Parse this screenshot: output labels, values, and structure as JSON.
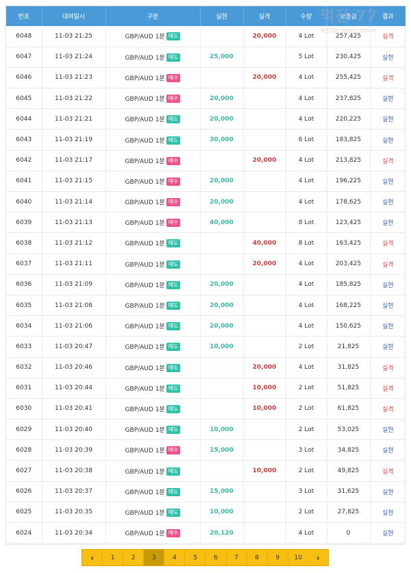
{
  "table": {
    "headers": [
      "번호",
      "대여일시",
      "구분",
      "실현",
      "실격",
      "수량",
      "보증금",
      "결과"
    ],
    "rows": [
      {
        "no": "6048",
        "time": "11-03 21:25",
        "product": "GBP/AUD 1분",
        "side": "매도",
        "side_type": "sell",
        "profit": "",
        "loss": "20,000",
        "qty": "4 Lot",
        "deposit": "257,425",
        "result": "실격",
        "result_type": "loss"
      },
      {
        "no": "6047",
        "time": "11-03 21:24",
        "product": "GBP/AUD 1분",
        "side": "매도",
        "side_type": "sell",
        "profit": "25,000",
        "loss": "",
        "qty": "5 Lot",
        "deposit": "230,425",
        "result": "실현",
        "result_type": "profit"
      },
      {
        "no": "6046",
        "time": "11-03 21:23",
        "product": "GBP/AUD 1분",
        "side": "매수",
        "side_type": "buy",
        "profit": "",
        "loss": "20,000",
        "qty": "4 Lot",
        "deposit": "255,425",
        "result": "실격",
        "result_type": "loss"
      },
      {
        "no": "6045",
        "time": "11-03 21:22",
        "product": "GBP/AUD 1분",
        "side": "매수",
        "side_type": "buy",
        "profit": "20,000",
        "loss": "",
        "qty": "4 Lot",
        "deposit": "237,825",
        "result": "실현",
        "result_type": "profit"
      },
      {
        "no": "6044",
        "time": "11-03 21:21",
        "product": "GBP/AUD 1분",
        "side": "매도",
        "side_type": "sell",
        "profit": "20,000",
        "loss": "",
        "qty": "4 Lot",
        "deposit": "220,225",
        "result": "실현",
        "result_type": "profit"
      },
      {
        "no": "6043",
        "time": "11-03 21:19",
        "product": "GBP/AUD 1분",
        "side": "매도",
        "side_type": "sell",
        "profit": "30,000",
        "loss": "",
        "qty": "6 Lot",
        "deposit": "183,825",
        "result": "실현",
        "result_type": "profit"
      },
      {
        "no": "6042",
        "time": "11-03 21:17",
        "product": "GBP/AUD 1분",
        "side": "매수",
        "side_type": "buy",
        "profit": "",
        "loss": "20,000",
        "qty": "4 Lot",
        "deposit": "213,825",
        "result": "실격",
        "result_type": "loss"
      },
      {
        "no": "6041",
        "time": "11-03 21:15",
        "product": "GBP/AUD 1분",
        "side": "매수",
        "side_type": "buy",
        "profit": "20,000",
        "loss": "",
        "qty": "4 Lot",
        "deposit": "196,225",
        "result": "실현",
        "result_type": "profit"
      },
      {
        "no": "6040",
        "time": "11-03 21:14",
        "product": "GBP/AUD 1분",
        "side": "매수",
        "side_type": "buy",
        "profit": "20,000",
        "loss": "",
        "qty": "4 Lot",
        "deposit": "178,625",
        "result": "실현",
        "result_type": "profit"
      },
      {
        "no": "6039",
        "time": "11-03 21:13",
        "product": "GBP/AUD 1분",
        "side": "매수",
        "side_type": "buy",
        "profit": "40,000",
        "loss": "",
        "qty": "8 Lot",
        "deposit": "123,425",
        "result": "실현",
        "result_type": "profit"
      },
      {
        "no": "6038",
        "time": "11-03 21:12",
        "product": "GBP/AUD 1분",
        "side": "매도",
        "side_type": "sell",
        "profit": "",
        "loss": "40,000",
        "qty": "8 Lot",
        "deposit": "163,425",
        "result": "실격",
        "result_type": "loss"
      },
      {
        "no": "6037",
        "time": "11-03 21:11",
        "product": "GBP/AUD 1분",
        "side": "매도",
        "side_type": "sell",
        "profit": "",
        "loss": "20,000",
        "qty": "4 Lot",
        "deposit": "203,425",
        "result": "실격",
        "result_type": "loss"
      },
      {
        "no": "6036",
        "time": "11-03 21:09",
        "product": "GBP/AUD 1분",
        "side": "매도",
        "side_type": "sell",
        "profit": "20,000",
        "loss": "",
        "qty": "4 Lot",
        "deposit": "185,825",
        "result": "실현",
        "result_type": "profit"
      },
      {
        "no": "6035",
        "time": "11-03 21:08",
        "product": "GBP/AUD 1분",
        "side": "매도",
        "side_type": "sell",
        "profit": "20,000",
        "loss": "",
        "qty": "4 Lot",
        "deposit": "168,225",
        "result": "실현",
        "result_type": "profit"
      },
      {
        "no": "6034",
        "time": "11-03 21:06",
        "product": "GBP/AUD 1분",
        "side": "매도",
        "side_type": "sell",
        "profit": "20,000",
        "loss": "",
        "qty": "4 Lot",
        "deposit": "150,625",
        "result": "실현",
        "result_type": "profit"
      },
      {
        "no": "6033",
        "time": "11-03 20:47",
        "product": "GBP/AUD 1분",
        "side": "매도",
        "side_type": "sell",
        "profit": "10,000",
        "loss": "",
        "qty": "2 Lot",
        "deposit": "21,825",
        "result": "실현",
        "result_type": "profit"
      },
      {
        "no": "6032",
        "time": "11-03 20:46",
        "product": "GBP/AUD 1분",
        "side": "매도",
        "side_type": "sell",
        "profit": "",
        "loss": "20,000",
        "qty": "4 Lot",
        "deposit": "31,825",
        "result": "실격",
        "result_type": "loss"
      },
      {
        "no": "6031",
        "time": "11-03 20:44",
        "product": "GBP/AUD 1분",
        "side": "매도",
        "side_type": "sell",
        "profit": "",
        "loss": "10,000",
        "qty": "2 Lot",
        "deposit": "51,825",
        "result": "실격",
        "result_type": "loss"
      },
      {
        "no": "6030",
        "time": "11-03 20:41",
        "product": "GBP/AUD 1분",
        "side": "매도",
        "side_type": "sell",
        "profit": "",
        "loss": "10,000",
        "qty": "2 Lot",
        "deposit": "61,825",
        "result": "실격",
        "result_type": "loss"
      },
      {
        "no": "6029",
        "time": "11-03 20:40",
        "product": "GBP/AUD 1분",
        "side": "매도",
        "side_type": "sell",
        "profit": "10,000",
        "loss": "",
        "qty": "2 Lot",
        "deposit": "53,025",
        "result": "실현",
        "result_type": "profit"
      },
      {
        "no": "6028",
        "time": "11-03 20:39",
        "product": "GBP/AUD 1분",
        "side": "매수",
        "side_type": "buy",
        "profit": "15,000",
        "loss": "",
        "qty": "3 Lot",
        "deposit": "34,825",
        "result": "실현",
        "result_type": "profit"
      },
      {
        "no": "6027",
        "time": "11-03 20:38",
        "product": "GBP/AUD 1분",
        "side": "매도",
        "side_type": "sell",
        "profit": "",
        "loss": "10,000",
        "qty": "2 Lot",
        "deposit": "49,825",
        "result": "실격",
        "result_type": "loss"
      },
      {
        "no": "6026",
        "time": "11-03 20:37",
        "product": "GBP/AUD 1분",
        "side": "매도",
        "side_type": "sell",
        "profit": "15,000",
        "loss": "",
        "qty": "3 Lot",
        "deposit": "31,625",
        "result": "실현",
        "result_type": "profit"
      },
      {
        "no": "6025",
        "time": "11-03 20:35",
        "product": "GBP/AUD 1분",
        "side": "매도",
        "side_type": "sell",
        "profit": "10,000",
        "loss": "",
        "qty": "2 Lot",
        "deposit": "27,825",
        "result": "실현",
        "result_type": "profit"
      },
      {
        "no": "6024",
        "time": "11-03 20:34",
        "product": "GBP/AUD 1분",
        "side": "매수",
        "side_type": "buy",
        "profit": "20,120",
        "loss": "",
        "qty": "4 Lot",
        "deposit": "0",
        "result": "실현",
        "result_type": "profit"
      }
    ]
  },
  "pagination": {
    "prev_icon": "chevron-left-icon",
    "next_icon": "chevron-right-icon",
    "prev_glyph": "‹",
    "next_glyph": "›",
    "pages": [
      "1",
      "2",
      "3",
      "4",
      "5",
      "6",
      "7",
      "8",
      "9",
      "10"
    ],
    "current": "3"
  },
  "watermark": {
    "logo_text": "먹진 77",
    "sub_text": "먹진검증 신뢰받는 커뮤니티"
  },
  "colors": {
    "header_bg": "#4a9ad8",
    "profit_amount": "#3db8a4",
    "loss_amount": "#c94040",
    "result_profit": "#3f62b0",
    "result_loss": "#d04a4a",
    "sell_badge": "#2fc0a8",
    "buy_badge": "#ef4f8a",
    "pager_bg": "#f6bf12",
    "pager_active": "#c99a08"
  }
}
